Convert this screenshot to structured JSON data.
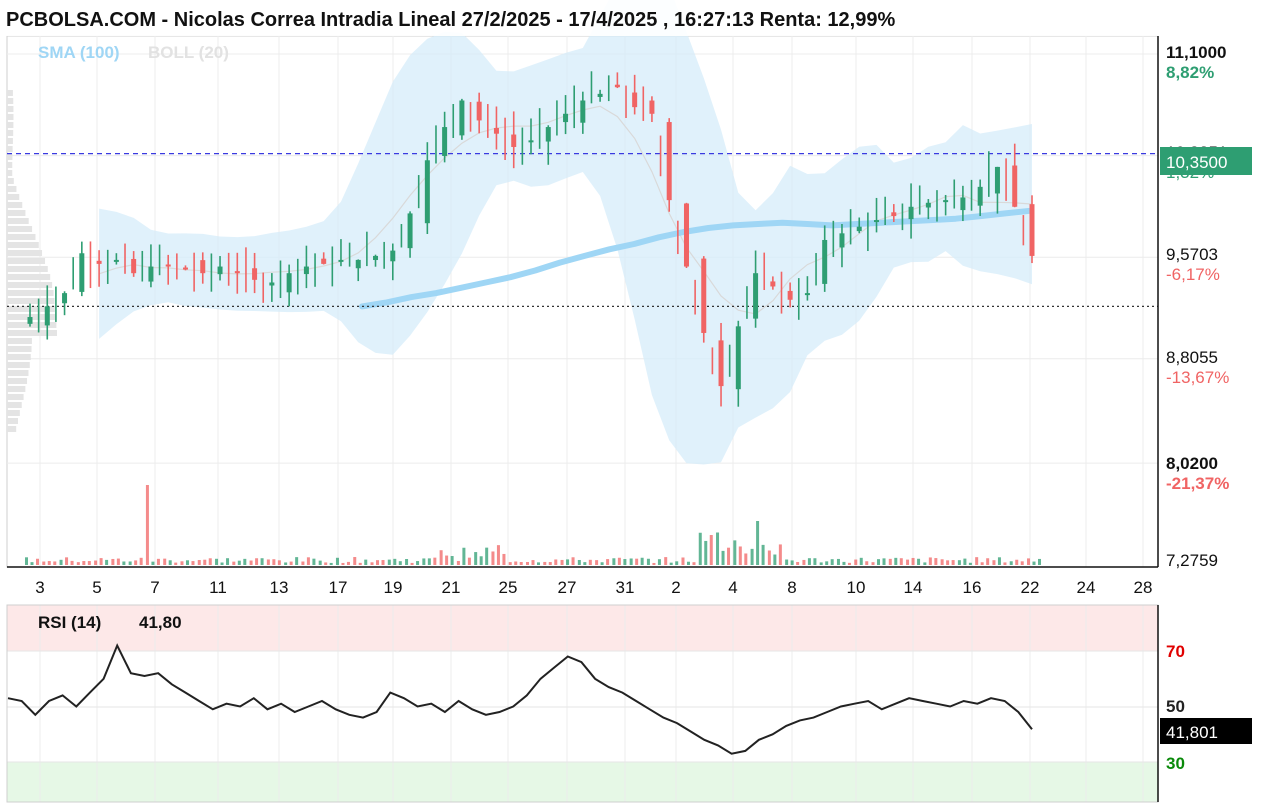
{
  "header": {
    "title": "PCBOLSA.COM - Nicolas Correa Intradia Lineal 27/2/2025 - 17/4/2025 , 16:27:13 Renta: 12,99%",
    "legend_sma": "SMA (100)",
    "legend_boll": "BOLL (20)"
  },
  "colors": {
    "up": "#2e9e72",
    "down": "#f06464",
    "sma": "#9fd6f5",
    "boll_fill": "#d6ecf9",
    "dashed_line": "#3a3ae0",
    "last_price_bg": "#2e9e72",
    "rsi_overbought_zone": "#fde8e8",
    "rsi_oversold_zone": "#e6f8e6",
    "rsi_line": "#222222"
  },
  "price_axis": {
    "labels": [
      {
        "value": "11,1000",
        "pct": "8,82%",
        "pct_color": "#2e9e72"
      },
      {
        "value": "10,3351",
        "pct": "1,32%",
        "pct_color": "#2e9e72"
      },
      {
        "value": "9,5703",
        "pct": "-6,17%",
        "pct_color": "#f06464"
      },
      {
        "value": "8,8055",
        "pct": "-13,67%",
        "pct_color": "#f06464"
      },
      {
        "value": "8,0200",
        "pct": "-21,37%",
        "pct_color": "#f06464"
      },
      {
        "value": "7,2759",
        "pct": "",
        "pct_color": ""
      }
    ],
    "last_price": "10,3500"
  },
  "x_axis": {
    "labels": [
      "3",
      "5",
      "7",
      "11",
      "13",
      "17",
      "19",
      "21",
      "25",
      "27",
      "31",
      "2",
      "4",
      "8",
      "10",
      "14",
      "16",
      "22",
      "24",
      "28"
    ]
  },
  "rsi": {
    "label": "RSI (14)",
    "value": "41,80",
    "last_value": "41,801",
    "levels": [
      {
        "label": "70",
        "color": "#e00000"
      },
      {
        "label": "50",
        "color": "#222222"
      },
      {
        "label": "30",
        "color": "#0a8a0a"
      }
    ]
  },
  "chart_data": {
    "type": "candlestick",
    "title": "PCBOLSA.COM - Nicolas Correa Intradia Lineal 27/2/2025 - 17/4/2025 , 16:27:13 Renta: 12,99%",
    "ylim": [
      7.2759,
      11.1
    ],
    "reference_lines": {
      "dashed_price": 10.35,
      "dotted_price": 9.2
    },
    "x_tick_labels": [
      "3",
      "5",
      "7",
      "11",
      "13",
      "17",
      "19",
      "21",
      "25",
      "27",
      "31",
      "2",
      "4",
      "8",
      "10",
      "14",
      "16",
      "22",
      "24",
      "28"
    ],
    "price_close": [
      9.12,
      9.2,
      9.3,
      9.6,
      9.52,
      9.55,
      9.45,
      9.5,
      9.5,
      9.48,
      9.45,
      9.5,
      9.45,
      9.4,
      9.38,
      9.45,
      9.5,
      9.52,
      9.55,
      9.55,
      9.58,
      9.62,
      9.9,
      10.3,
      10.55,
      10.75,
      10.6,
      10.5,
      10.4,
      10.45,
      10.55,
      10.65,
      10.75,
      10.8,
      10.85,
      10.7,
      10.65,
      10.0,
      9.5,
      9.0,
      8.6,
      9.05,
      9.45,
      9.35,
      9.25,
      9.3,
      9.7,
      9.75,
      9.8,
      9.85,
      9.88,
      9.95,
      9.98,
      10.0,
      10.02,
      10.1,
      10.25,
      9.95,
      9.58
    ],
    "sma_100": [
      9.2,
      9.23,
      9.27,
      9.3,
      9.34,
      9.38,
      9.42,
      9.47,
      9.53,
      9.58,
      9.63,
      9.67,
      9.72,
      9.76,
      9.79,
      9.81,
      9.82,
      9.83,
      9.82,
      9.81,
      9.82,
      9.83,
      9.84,
      9.85,
      9.86,
      9.88,
      9.9,
      9.92
    ],
    "volume_spike_positions": [
      "7",
      "8"
    ],
    "rsi_14": {
      "ylim": [
        0,
        100
      ],
      "overbought": 70,
      "oversold": 30,
      "last": 41.8,
      "values": [
        53,
        52,
        47,
        52,
        54,
        50,
        55,
        60,
        72,
        62,
        61,
        62,
        58,
        55,
        52,
        49,
        51,
        50,
        53,
        49,
        51,
        48,
        50,
        52,
        49,
        47,
        46,
        48,
        55,
        53,
        50,
        51,
        48,
        52,
        49,
        47,
        48,
        50,
        54,
        60,
        64,
        68,
        66,
        60,
        57,
        55,
        52,
        49,
        46,
        44,
        41,
        38,
        36,
        33,
        34,
        38,
        40,
        43,
        45,
        46,
        48,
        50,
        51,
        52,
        49,
        51,
        53,
        52,
        51,
        50,
        52,
        51,
        53,
        52,
        48,
        41.8
      ],
      "note": ""
    }
  }
}
